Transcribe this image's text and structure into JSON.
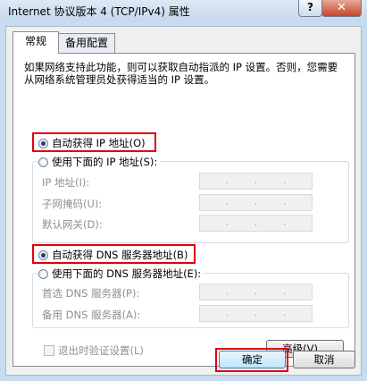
{
  "window": {
    "title": "Internet 协议版本 4 (TCP/IPv4) 属性",
    "help_label": "?",
    "close_label": "✕"
  },
  "tabs": [
    {
      "label": "常规",
      "active": true
    },
    {
      "label": "备用配置",
      "active": false
    }
  ],
  "description": "如果网络支持此功能，则可以获取自动指派的 IP 设置。否则，您需要从网络系统管理员处获得适当的 IP 设置。",
  "ip_section": {
    "auto_label": "自动获得 IP 地址(O)",
    "manual_label": "使用下面的 IP 地址(S):",
    "selected": "auto",
    "fields": [
      {
        "label": "IP 地址(I):",
        "value": ". . ."
      },
      {
        "label": "子网掩码(U):",
        "value": ". . ."
      },
      {
        "label": "默认网关(D):",
        "value": ". . ."
      }
    ]
  },
  "dns_section": {
    "auto_label": "自动获得 DNS 服务器地址(B)",
    "manual_label": "使用下面的 DNS 服务器地址(E):",
    "selected": "auto",
    "fields": [
      {
        "label": "首选 DNS 服务器(P):",
        "value": ". . ."
      },
      {
        "label": "备用 DNS 服务器(A):",
        "value": ". . ."
      }
    ]
  },
  "validate_label": "退出时验证设置(L)",
  "validate_checked": false,
  "buttons": {
    "advanced": "高级(V)...",
    "ok": "确定",
    "cancel": "取消"
  },
  "colors": {
    "highlight": "#e0000c",
    "titlebar": "#c9dbee"
  }
}
